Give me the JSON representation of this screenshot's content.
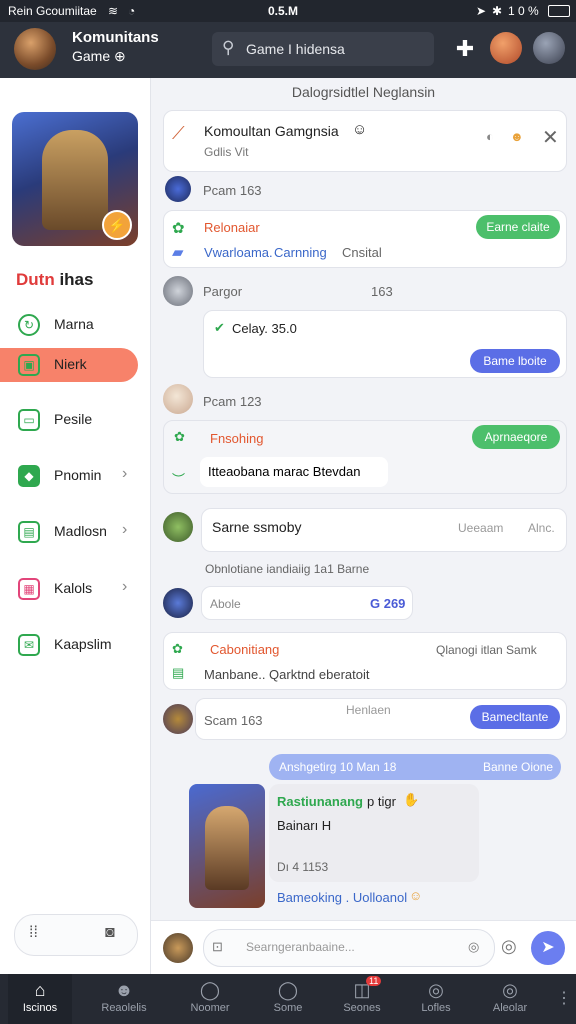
{
  "status": {
    "left": "Rein Gcoumiitae",
    "center": "0.5.M",
    "battery": "1 0 %"
  },
  "topbar": {
    "title": "Komunitans",
    "subtitle": "Game",
    "search_text": "Game I hidensa"
  },
  "sidebar": {
    "title_a": "Dutn",
    "title_b": " ihas",
    "items": [
      {
        "label": "Marna"
      },
      {
        "label": "Nierk"
      },
      {
        "label": "Pesile"
      },
      {
        "label": "Pnomin"
      },
      {
        "label": "Madlosn"
      },
      {
        "label": "Kalols"
      },
      {
        "label": "Kaapslim"
      }
    ]
  },
  "main": {
    "section_title": "Dalogrsidtlel Neglansin",
    "pinned": {
      "title": "Komoultan Gamgnsia",
      "sub": "Gdlis Vit"
    },
    "feed": {
      "m1_user": "Pcam 163",
      "m1_title": "Relonaiar",
      "m1_sub_a": "Vwarloama.",
      "m1_sub_b": "Carnning",
      "m1_sub_c": "Cnsital",
      "m1_pill": "Earne claite",
      "m2_user": "Pargor",
      "m2_count": "163",
      "m2_text": "Celay. 35.0",
      "m2_pill": "Bame lboite",
      "m3_user": "Pcam 123",
      "m3_title": "Fnsohing",
      "m3_pill": "Aprnaeqore",
      "m3_sub": "Itteaobana marac Btevdan",
      "m4_text": "Sarne ssmoby",
      "m4_right": "Ueeaam",
      "m4_right2": "Alnc.",
      "m5_label": "Obnlotiane iandiaiig 1a1 Barne",
      "m5_field": "Abole",
      "m5_value": "G 269",
      "m6_title": "Cabonitiang",
      "m6_right": "Qlanogi itlan Samk",
      "m6_sub": "Manbane.. Qarktnd eberatoit",
      "m7_user": "Scam 163",
      "m7_mid": "Henlaen",
      "m7_pill": "Bamecltante",
      "m8_banner": "Anshgetirg 10 Man 18",
      "m8_banner_r": "Banne Oione",
      "m8_title": "Rastiunanang",
      "m8_title2": "p tigr",
      "m8_line": "Bainarı H",
      "m8_stamp": "Dı 4 1153",
      "m8_footer": "Bameoking . Uolloanol"
    },
    "composer_placeholder": "Searngeranbaaine..."
  },
  "bottom_nav": [
    {
      "label": "Iscinos"
    },
    {
      "label": "Reaolelis"
    },
    {
      "label": "Noomer"
    },
    {
      "label": "Some"
    },
    {
      "label": "Seones",
      "badge": "11"
    },
    {
      "label": "Lofles"
    },
    {
      "label": "Aleolar"
    }
  ],
  "colors": {
    "accent": "#f7826a",
    "green": "#4cbf6b",
    "blue": "#5b6ee6",
    "topbar": "#2d323c"
  }
}
